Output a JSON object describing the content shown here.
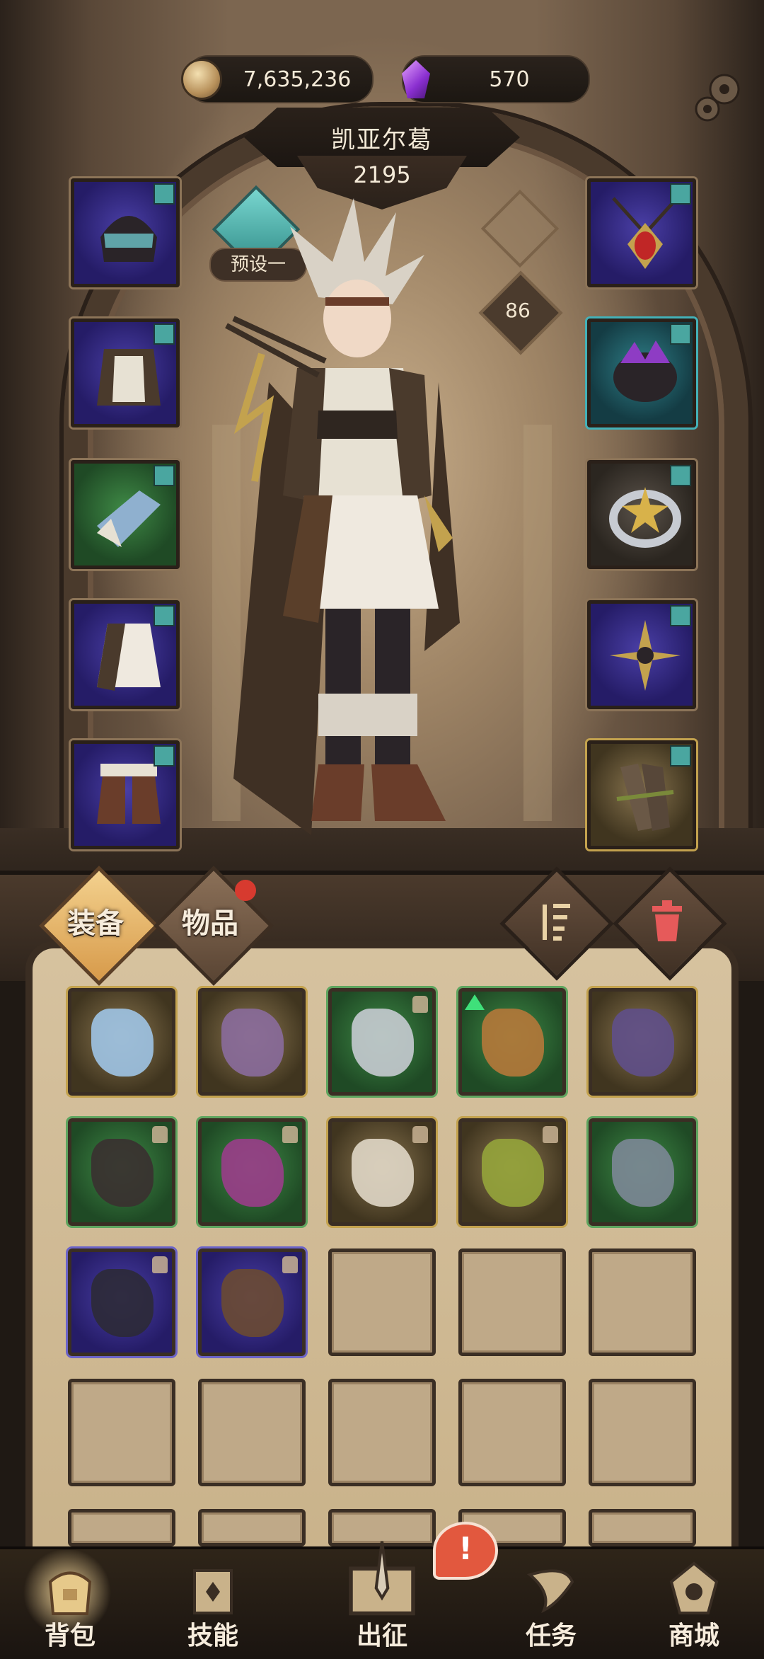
{
  "currency": {
    "coins": "7,635,236",
    "gems": "570"
  },
  "hero": {
    "name": "凯亚尔葛",
    "power": "2195",
    "preset": "预设一",
    "level": "86"
  },
  "equipment": {
    "left": [
      "helmet",
      "chest-armor",
      "gloves",
      "skirt",
      "boots"
    ],
    "right": [
      "amulet",
      "spiked-ring",
      "star-ring",
      "crossbow-emblem",
      "quiver"
    ]
  },
  "inventory": {
    "tabs": {
      "equip": "装备",
      "items": "物品"
    },
    "items": [
      {
        "name": "ice-crystal-armor",
        "rarity": "gold",
        "locked": false
      },
      {
        "name": "demon-skull-shoulder",
        "rarity": "gold",
        "locked": false
      },
      {
        "name": "silver-eye-ring",
        "rarity": "green",
        "locked": true
      },
      {
        "name": "bronze-eye-ring",
        "rarity": "green",
        "locked": false,
        "upgrade": true
      },
      {
        "name": "grape-thorn-weapon",
        "rarity": "gold",
        "locked": false
      },
      {
        "name": "gem-necklace",
        "rarity": "green",
        "locked": true
      },
      {
        "name": "purple-horns",
        "rarity": "green",
        "locked": true
      },
      {
        "name": "skull-pauldron",
        "rarity": "gold",
        "locked": true
      },
      {
        "name": "thorn-gauntlet",
        "rarity": "gold",
        "locked": true
      },
      {
        "name": "steel-greaves",
        "rarity": "green",
        "locked": false
      },
      {
        "name": "dark-boots",
        "rarity": "purple",
        "locked": true
      },
      {
        "name": "leather-vest",
        "rarity": "purple",
        "locked": true
      }
    ]
  },
  "nav": {
    "bag": "背包",
    "skills": "技能",
    "expedition": "出征",
    "quests": "任务",
    "shop": "商城",
    "alert": "!"
  },
  "colors": {
    "rare_purple": "#3a2f8f",
    "rare_green": "#2f6a36",
    "rare_gold": "#c3a24e",
    "accent_teal": "#4aa6a0",
    "alert_red": "#e2583e"
  }
}
